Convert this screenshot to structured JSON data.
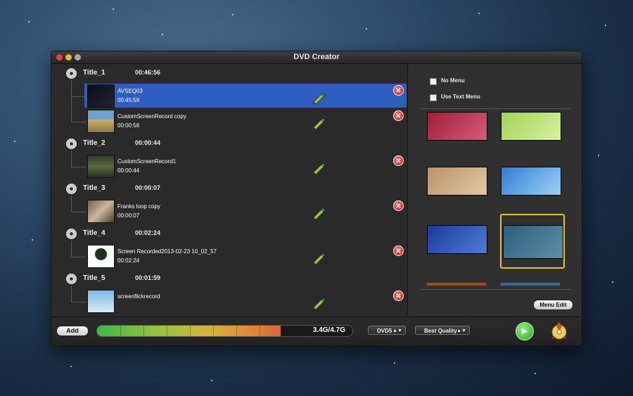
{
  "window": {
    "title": "DVD Creator"
  },
  "titles": [
    {
      "name": "Title_1",
      "duration": "00:46:56",
      "clips": [
        {
          "name": "AVSEQ03",
          "duration": "00:45:59",
          "selected": true,
          "thumb": "dark-video"
        },
        {
          "name": "CustomScreenRecord copy",
          "duration": "00:00:56",
          "selected": false,
          "thumb": "desktop-landscape"
        }
      ]
    },
    {
      "name": "Title_2",
      "duration": "00:00:44",
      "clips": [
        {
          "name": "CustomScreenRecord1",
          "duration": "00:00:44",
          "selected": false,
          "thumb": "forest"
        }
      ]
    },
    {
      "name": "Title_3",
      "duration": "00:00:07",
      "clips": [
        {
          "name": "Franks loop copy",
          "duration": "00:00:07",
          "selected": false,
          "thumb": "rocks"
        }
      ]
    },
    {
      "name": "Title_4",
      "duration": "00:02:24",
      "clips": [
        {
          "name": "Screen Recorded2013-02-23 10_02_57",
          "duration": "00:02:24",
          "selected": false,
          "thumb": "tree-white"
        }
      ]
    },
    {
      "name": "Title_5",
      "duration": "00:01:59",
      "clips": [
        {
          "name": "screenflickrecord",
          "duration": "",
          "selected": false,
          "thumb": "sky"
        }
      ]
    }
  ],
  "menu_options": {
    "no_menu": {
      "label": "No Menu",
      "checked": false
    },
    "text_menu": {
      "label": "Use Text Menu",
      "checked": false
    }
  },
  "templates": [
    {
      "name": "red-flowers",
      "colors": [
        "#9b1e3a",
        "#d85c7a"
      ]
    },
    {
      "name": "green-clover",
      "colors": [
        "#9fd45a",
        "#d9f0a0"
      ]
    },
    {
      "name": "wood-orchid",
      "colors": [
        "#b9926a",
        "#e2c8a4"
      ]
    },
    {
      "name": "blue-sky",
      "colors": [
        "#2f7ed8",
        "#9dd0f5"
      ]
    },
    {
      "name": "christmas",
      "colors": [
        "#1c3b9a",
        "#4f7cd8"
      ]
    },
    {
      "name": "night-moon",
      "colors": [
        "#2c5f7e",
        "#5e8fa8"
      ],
      "selected": true
    }
  ],
  "buttons": {
    "menu_edit": "Menu Edit",
    "add": "Add"
  },
  "capacity": {
    "used": "3.4G",
    "total": "4.7G",
    "text": "3.4G/4.7G",
    "fraction": 0.72
  },
  "disc_type": "DVD5",
  "quality": "Best Quality",
  "icons": {
    "remove": "✕",
    "play": "▶"
  }
}
